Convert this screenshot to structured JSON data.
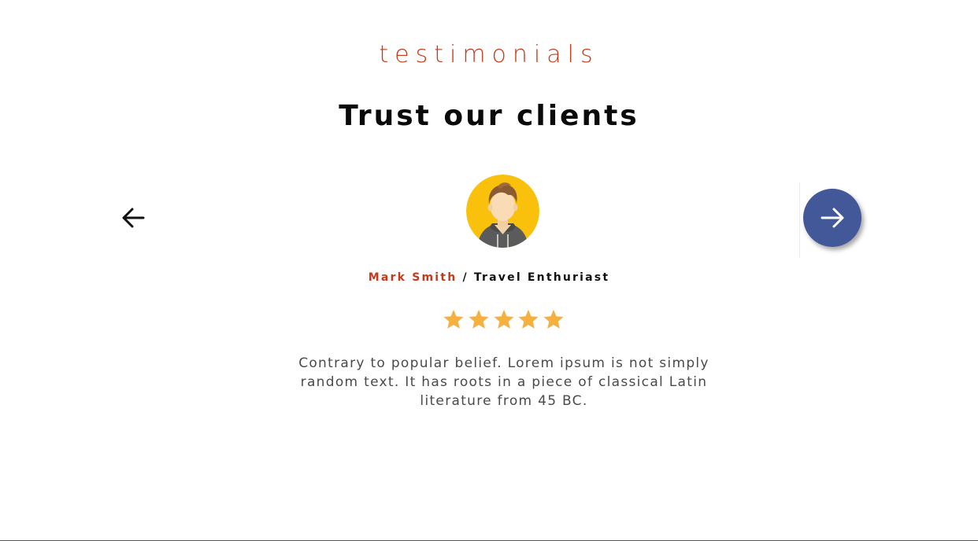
{
  "section": {
    "eyebrow": "testimonials",
    "title": "Trust our clients"
  },
  "testimonial": {
    "name": "Mark Smith",
    "separator": " / ",
    "role": "Travel Enthuriast",
    "rating": 5,
    "rating_max": 5,
    "quote": "Contrary to popular belief. Lorem ipsum is not simply random text. It has roots in a piece of classical Latin literature from 45 BC."
  },
  "colors": {
    "accent": "#c8391a",
    "nav_button": "#435898",
    "star": "#f6b040",
    "avatar_bg": "#f9c10b"
  },
  "icons": {
    "prev": "arrow-left-icon",
    "next": "arrow-right-icon"
  }
}
